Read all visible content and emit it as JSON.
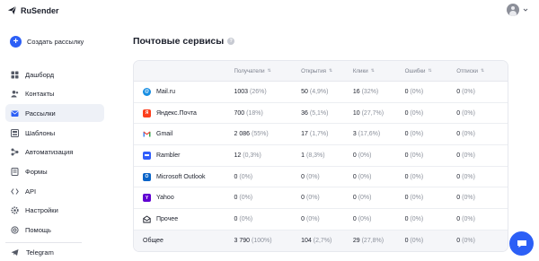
{
  "header": {
    "brand": "RuSender",
    "user_avatar_icon": "user-avatar-icon",
    "menu_icon": "chevron-down-icon"
  },
  "sidebar": {
    "create_label": "Создать рассылку",
    "items": [
      {
        "label": "Дашборд",
        "icon": "dashboard-icon",
        "active": false
      },
      {
        "label": "Контакты",
        "icon": "contacts-icon",
        "active": false
      },
      {
        "label": "Рассылки",
        "icon": "mailings-icon",
        "active": true
      },
      {
        "label": "Шаблоны",
        "icon": "templates-icon",
        "active": false
      },
      {
        "label": "Автоматизация",
        "icon": "automation-icon",
        "active": false
      },
      {
        "label": "Формы",
        "icon": "forms-icon",
        "active": false
      },
      {
        "label": "API",
        "icon": "api-icon",
        "active": false
      },
      {
        "label": "Настройки",
        "icon": "settings-icon",
        "active": false
      },
      {
        "label": "Помощь",
        "icon": "help-icon",
        "active": false
      }
    ],
    "telegram_label": "Telegram"
  },
  "main": {
    "title": "Почтовые сервисы",
    "columns": [
      "Получатели",
      "Открытия",
      "Клики",
      "Ошибки",
      "Отписки"
    ],
    "rows": [
      {
        "service": "Mail.ru",
        "icon": "mailru-icon",
        "cells": [
          [
            "1003",
            "(26%)"
          ],
          [
            "50",
            "(4,9%)"
          ],
          [
            "16",
            "(32%)"
          ],
          [
            "0",
            "(0%)"
          ],
          [
            "0",
            "(0%)"
          ]
        ]
      },
      {
        "service": "Яндекс.Почта",
        "icon": "yandex-icon",
        "cells": [
          [
            "700",
            "(18%)"
          ],
          [
            "36",
            "(5,1%)"
          ],
          [
            "10",
            "(27,7%)"
          ],
          [
            "0",
            "(0%)"
          ],
          [
            "0",
            "(0%)"
          ]
        ]
      },
      {
        "service": "Gmail",
        "icon": "gmail-icon",
        "cells": [
          [
            "2 086",
            "(55%)"
          ],
          [
            "17",
            "(1,7%)"
          ],
          [
            "3",
            "(17,6%)"
          ],
          [
            "0",
            "(0%)"
          ],
          [
            "0",
            "(0%)"
          ]
        ]
      },
      {
        "service": "Rambler",
        "icon": "rambler-icon",
        "cells": [
          [
            "12",
            "(0,3%)"
          ],
          [
            "1",
            "(8,3%)"
          ],
          [
            "0",
            "(0%)"
          ],
          [
            "0",
            "(0%)"
          ],
          [
            "0",
            "(0%)"
          ]
        ]
      },
      {
        "service": "Microsoft Outlook",
        "icon": "outlook-icon",
        "cells": [
          [
            "0",
            "(0%)"
          ],
          [
            "0",
            "(0%)"
          ],
          [
            "0",
            "(0%)"
          ],
          [
            "0",
            "(0%)"
          ],
          [
            "0",
            "(0%)"
          ]
        ]
      },
      {
        "service": "Yahoo",
        "icon": "yahoo-icon",
        "cells": [
          [
            "0",
            "(0%)"
          ],
          [
            "0",
            "(0%)"
          ],
          [
            "0",
            "(0%)"
          ],
          [
            "0",
            "(0%)"
          ],
          [
            "0",
            "(0%)"
          ]
        ]
      },
      {
        "service": "Прочее",
        "icon": "other-mail-icon",
        "cells": [
          [
            "0",
            "(0%)"
          ],
          [
            "0",
            "(0%)"
          ],
          [
            "0",
            "(0%)"
          ],
          [
            "0",
            "(0%)"
          ],
          [
            "0",
            "(0%)"
          ]
        ]
      }
    ],
    "total": {
      "label": "Общее",
      "cells": [
        [
          "3 790",
          "(100%)"
        ],
        [
          "104",
          "(2,7%)"
        ],
        [
          "29",
          "(27,8%)"
        ],
        [
          "0",
          "(0%)"
        ],
        [
          "0",
          "(0%)"
        ]
      ]
    }
  },
  "colors": {
    "accent": "#2c5ff6",
    "mailru": "#168de2",
    "yandex": "#fc3f1d",
    "gmail": "#ea4335",
    "rambler": "#315efb",
    "outlook": "#0a64c8",
    "yahoo": "#6001d2"
  }
}
